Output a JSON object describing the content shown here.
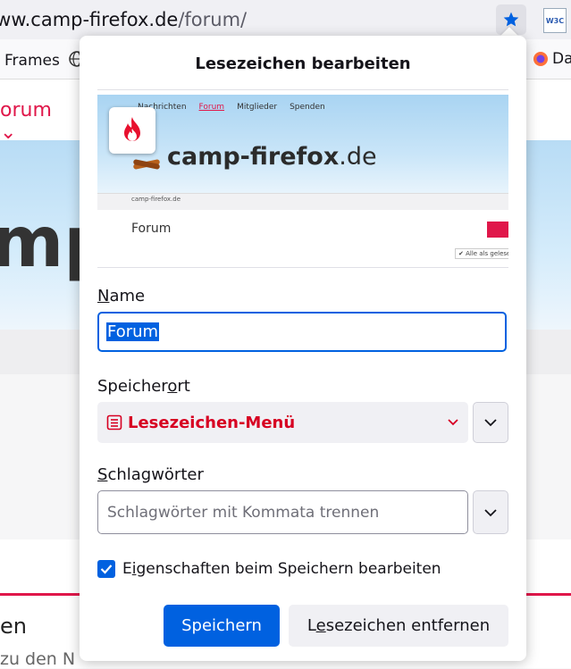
{
  "browser": {
    "url_host": "www.camp-firefox.de",
    "url_path": "/forum/",
    "bookmark_star_icon": "star-filled-icon",
    "extension_icon": "w3c-validator-icon",
    "toolbar_frames_label": "Frames",
    "toolbar_da_label": "Da"
  },
  "background_page": {
    "nav_tab": "orum",
    "logo_fragment": "mp-",
    "heading_fragment": "en",
    "subtext_fragment": "zu den N"
  },
  "panel": {
    "title": "Lesezeichen bearbeiten",
    "preview": {
      "nav_items": [
        "Nachrichten",
        "Forum",
        "Mitglieder",
        "Spenden"
      ],
      "brand": "camp-firefox",
      "brand_tld": ".de",
      "breadcrumb": "camp-firefox.de",
      "page_heading": "Forum",
      "mark_all_read": "Alle als gelesen"
    },
    "name_label_first": "N",
    "name_label_rest": "ame",
    "name_value": "Forum",
    "location_label_a": "Speicher",
    "location_label_u": "o",
    "location_label_b": "rt",
    "location_value": "Lesezeichen-Menü",
    "tags_label_u": "S",
    "tags_label_rest": "chlagwörter",
    "tags_placeholder": "Schlagwörter mit Kommata trennen",
    "checkbox_label_a": "E",
    "checkbox_label_u": "i",
    "checkbox_label_b": "genschaften beim Speichern bearbeiten",
    "checkbox_checked": true,
    "save_button": "Speichern",
    "remove_button_a": "L",
    "remove_button_u": "e",
    "remove_button_b": "sezeichen entfernen"
  },
  "colors": {
    "accent": "#0061e0",
    "folder_red": "#d70022",
    "site_red": "#e0174a"
  }
}
